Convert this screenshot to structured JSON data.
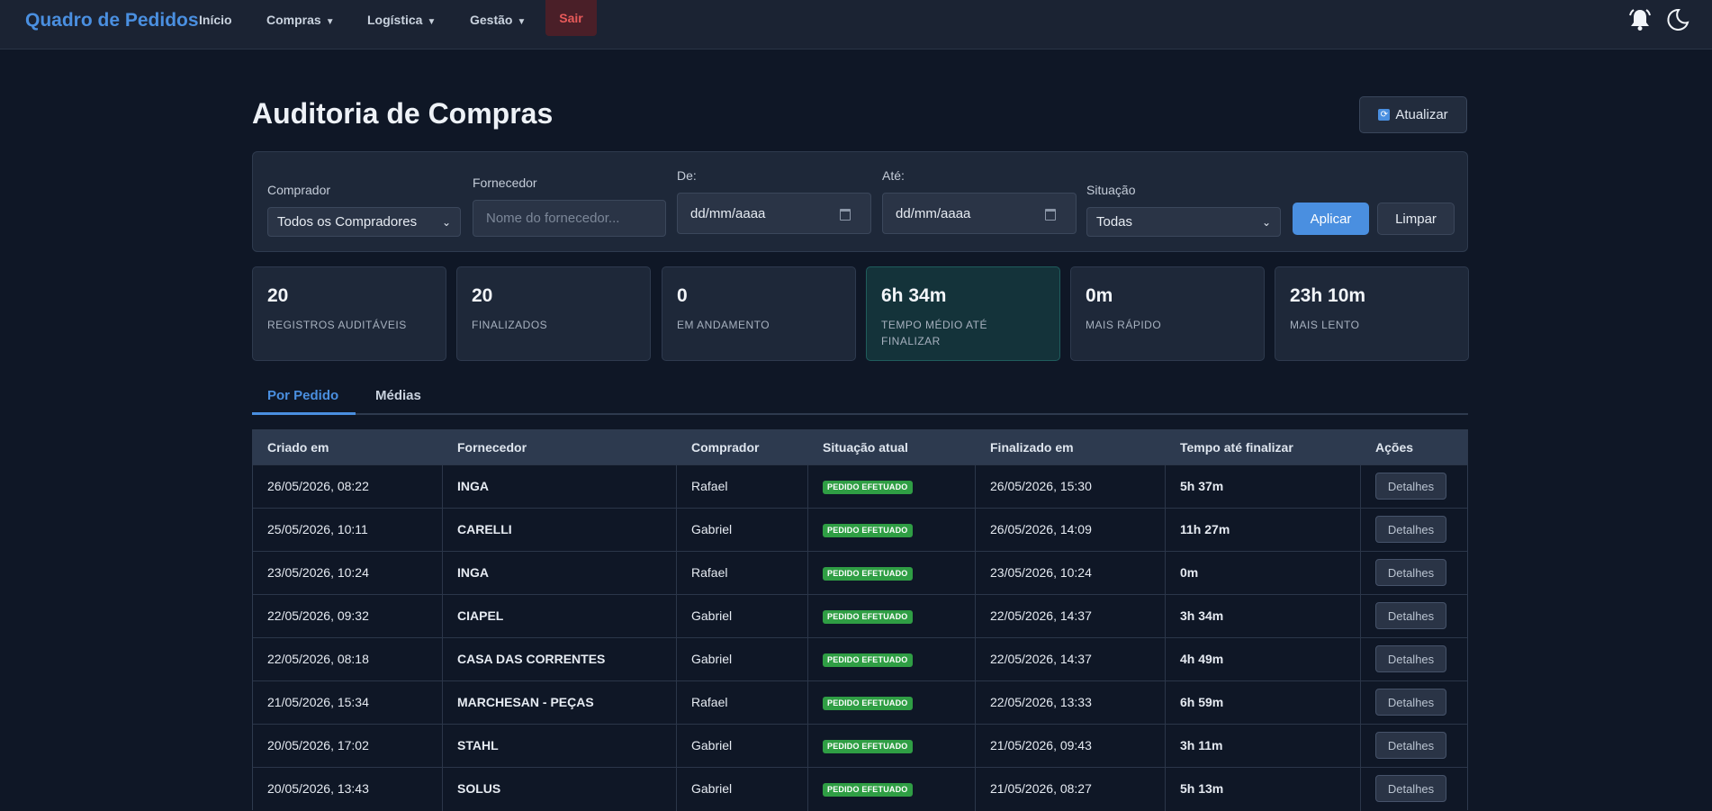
{
  "nav": {
    "brand": "Quadro de Pedidos",
    "links": [
      {
        "label": "Início",
        "caret": ""
      },
      {
        "label": "Compras",
        "caret": "▼"
      },
      {
        "label": "Logística",
        "caret": "▼"
      },
      {
        "label": "Gestão",
        "caret": "▼"
      }
    ],
    "logout": "Sair",
    "icons": [
      "bell-icon",
      "theme-toggle-icon"
    ]
  },
  "page": {
    "title": "Auditoria de Compras",
    "refresh_label": "Atualizar",
    "refresh_icon": "refresh-icon"
  },
  "filters": {
    "buyer": {
      "label": "Comprador",
      "value": "Todos os Compradores"
    },
    "supplier": {
      "label": "Fornecedor",
      "placeholder": "Nome do fornecedor..."
    },
    "from": {
      "label": "De:",
      "placeholder": "dd/mm/aaaa"
    },
    "to": {
      "label": "Até:",
      "placeholder": "dd/mm/aaaa"
    },
    "status": {
      "label": "Situação",
      "value": "Todas"
    },
    "apply": "Aplicar",
    "clear": "Limpar"
  },
  "stats": [
    {
      "value": "20",
      "label": "REGISTROS AUDITÁVEIS"
    },
    {
      "value": "20",
      "label": "FINALIZADOS"
    },
    {
      "value": "0",
      "label": "EM ANDAMENTO"
    },
    {
      "value": "6h 34m",
      "label": "TEMPO MÉDIO ATÉ FINALIZAR"
    },
    {
      "value": "0m",
      "label": "MAIS RÁPIDO"
    },
    {
      "value": "23h 10m",
      "label": "MAIS LENTO"
    }
  ],
  "tabs": [
    "Por Pedido",
    "Médias"
  ],
  "table": {
    "headers": [
      "Criado em",
      "Fornecedor",
      "Comprador",
      "Situação atual",
      "Finalizado em",
      "Tempo até finalizar",
      "Ações"
    ],
    "details_label": "Detalhes",
    "rows": [
      {
        "created": "26/05/2026, 08:22",
        "supplier": "INGA",
        "buyer": "Rafael",
        "status": "PEDIDO EFETUADO",
        "finished": "26/05/2026, 15:30",
        "time": "5h 37m"
      },
      {
        "created": "25/05/2026, 10:11",
        "supplier": "CARELLI",
        "buyer": "Gabriel",
        "status": "PEDIDO EFETUADO",
        "finished": "26/05/2026, 14:09",
        "time": "11h 27m"
      },
      {
        "created": "23/05/2026, 10:24",
        "supplier": "INGA",
        "buyer": "Rafael",
        "status": "PEDIDO EFETUADO",
        "finished": "23/05/2026, 10:24",
        "time": "0m"
      },
      {
        "created": "22/05/2026, 09:32",
        "supplier": "CIAPEL",
        "buyer": "Gabriel",
        "status": "PEDIDO EFETUADO",
        "finished": "22/05/2026, 14:37",
        "time": "3h 34m"
      },
      {
        "created": "22/05/2026, 08:18",
        "supplier": "CASA DAS CORRENTES",
        "buyer": "Gabriel",
        "status": "PEDIDO EFETUADO",
        "finished": "22/05/2026, 14:37",
        "time": "4h 49m"
      },
      {
        "created": "21/05/2026, 15:34",
        "supplier": "MARCHESAN - PEÇAS",
        "buyer": "Rafael",
        "status": "PEDIDO EFETUADO",
        "finished": "22/05/2026, 13:33",
        "time": "6h 59m"
      },
      {
        "created": "20/05/2026, 17:02",
        "supplier": "STAHL",
        "buyer": "Gabriel",
        "status": "PEDIDO EFETUADO",
        "finished": "21/05/2026, 09:43",
        "time": "3h 11m"
      },
      {
        "created": "20/05/2026, 13:43",
        "supplier": "SOLUS",
        "buyer": "Gabriel",
        "status": "PEDIDO EFETUADO",
        "finished": "21/05/2026, 08:27",
        "time": "5h 13m"
      }
    ]
  }
}
